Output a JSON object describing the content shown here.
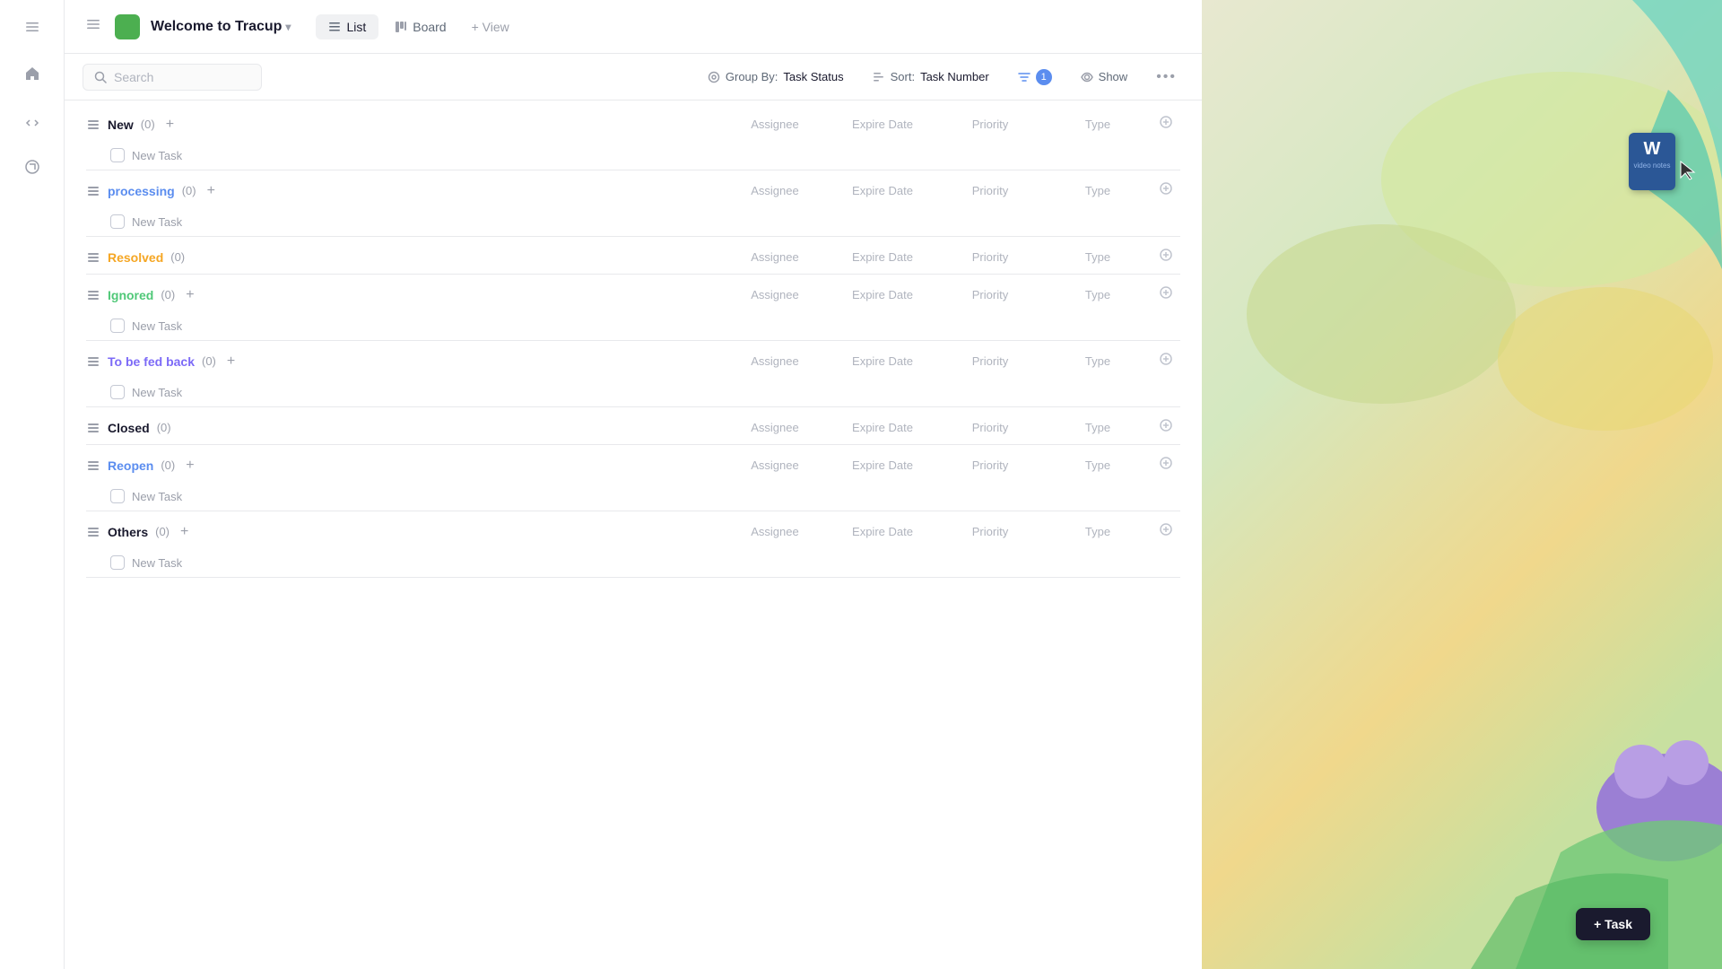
{
  "sidebar": {
    "collapse_icon": "☰",
    "icons": [
      {
        "name": "menu-icon",
        "symbol": "☰"
      },
      {
        "name": "refresh-icon",
        "symbol": "↻"
      },
      {
        "name": "layers-icon",
        "symbol": "⊞"
      }
    ]
  },
  "topbar": {
    "workspace": {
      "color": "#4caf50",
      "title": "Welcome to Tracup",
      "dropdown_icon": "▾"
    },
    "tabs": [
      {
        "id": "list",
        "label": "List",
        "active": true,
        "icon": "≡"
      },
      {
        "id": "board",
        "label": "Board",
        "active": false,
        "icon": "⊞"
      }
    ],
    "add_view_label": "+ View"
  },
  "toolbar": {
    "search_placeholder": "Search",
    "group_by_label": "Group By:",
    "group_by_value": "Task Status",
    "sort_label": "Sort:",
    "sort_value": "Task Number",
    "filter_count": "1",
    "show_label": "Show",
    "more_icon": "•••"
  },
  "columns": {
    "assignee": "Assignee",
    "expire_date": "Expire Date",
    "priority": "Priority",
    "type": "Type"
  },
  "sections": [
    {
      "id": "new",
      "label": "New",
      "count": "(0)",
      "color_class": "color-new",
      "has_add": true,
      "tasks": [
        {
          "label": "New Task"
        }
      ]
    },
    {
      "id": "processing",
      "label": "processing",
      "count": "(0)",
      "color_class": "color-processing",
      "has_add": true,
      "tasks": [
        {
          "label": "New Task"
        }
      ]
    },
    {
      "id": "resolved",
      "label": "Resolved",
      "count": "(0)",
      "color_class": "color-resolved",
      "has_add": false,
      "tasks": []
    },
    {
      "id": "ignored",
      "label": "Ignored",
      "count": "(0)",
      "color_class": "color-ignored",
      "has_add": true,
      "tasks": [
        {
          "label": "New Task"
        }
      ]
    },
    {
      "id": "to-be-fed-back",
      "label": "To be fed back",
      "count": "(0)",
      "color_class": "color-fed-back",
      "has_add": true,
      "tasks": [
        {
          "label": "New Task"
        }
      ]
    },
    {
      "id": "closed",
      "label": "Closed",
      "count": "(0)",
      "color_class": "color-closed",
      "has_add": false,
      "tasks": []
    },
    {
      "id": "reopen",
      "label": "Reopen",
      "count": "(0)",
      "color_class": "color-reopen",
      "has_add": true,
      "tasks": [
        {
          "label": "New Task"
        }
      ]
    },
    {
      "id": "others",
      "label": "Others",
      "count": "(0)",
      "color_class": "color-others",
      "has_add": true,
      "tasks": [
        {
          "label": "New Task"
        }
      ]
    }
  ],
  "fab": {
    "label": "+ Task"
  }
}
